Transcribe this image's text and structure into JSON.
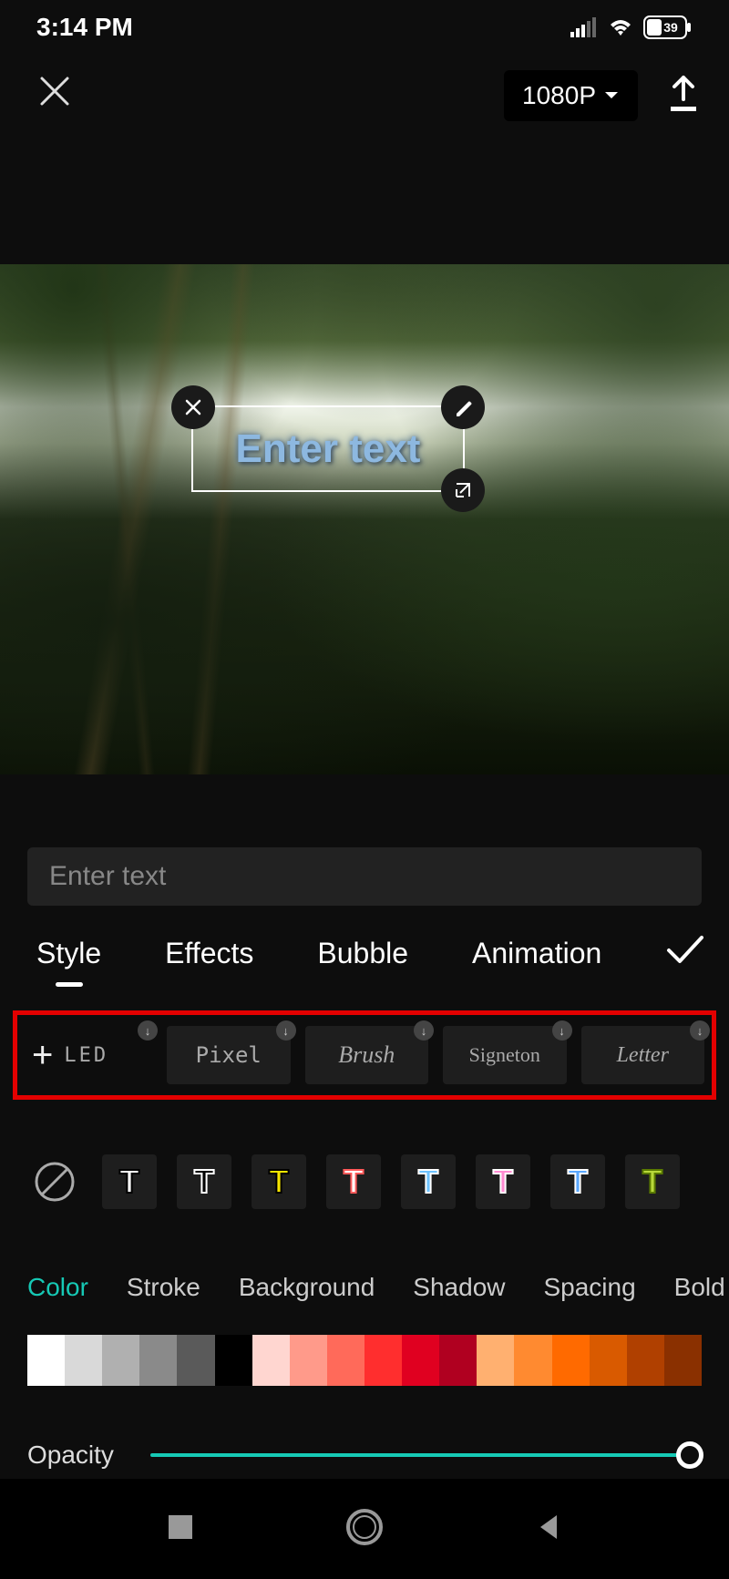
{
  "status": {
    "time": "3:14 PM",
    "battery": "39"
  },
  "header": {
    "resolution": "1080P"
  },
  "overlay": {
    "placeholder": "Enter text"
  },
  "textInput": {
    "placeholder": "Enter text",
    "value": ""
  },
  "tabs": [
    "Style",
    "Effects",
    "Bubble",
    "Animation"
  ],
  "activeTab": 0,
  "fonts": [
    "LED",
    "Pixel",
    "Brush",
    "Signeton",
    "Letter"
  ],
  "textStyles": [
    {
      "fill": "#ffffff",
      "stroke": "#000000"
    },
    {
      "fill": "#000000",
      "stroke": "#ffffff"
    },
    {
      "fill": "#f7e600",
      "stroke": "#000000"
    },
    {
      "fill": "#ffffff",
      "stroke": "#ff5a5a"
    },
    {
      "fill": "#6ec3ff",
      "stroke": "#ffffff"
    },
    {
      "fill": "#ff8ad1",
      "stroke": "#ffffff"
    },
    {
      "fill": "#5aa8ff",
      "stroke": "#ffffff"
    },
    {
      "fill": "#b8d93a",
      "stroke": "#5a7a00"
    }
  ],
  "properties": [
    "Color",
    "Stroke",
    "Background",
    "Shadow",
    "Spacing",
    "Bold ital"
  ],
  "activeProperty": 0,
  "colorStrip": [
    "#ffffff",
    "#d9d9d9",
    "#b0b0b0",
    "#8a8a8a",
    "#5a5a5a",
    "#000000",
    "#ffd6d0",
    "#ff9a8a",
    "#ff6a5a",
    "#ff2e2e",
    "#e00020",
    "#b00020",
    "#ffb070",
    "#ff8a30",
    "#ff6a00",
    "#d95a00",
    "#b04000",
    "#8a3000"
  ],
  "opacity": {
    "label": "Opacity",
    "value": 100
  }
}
